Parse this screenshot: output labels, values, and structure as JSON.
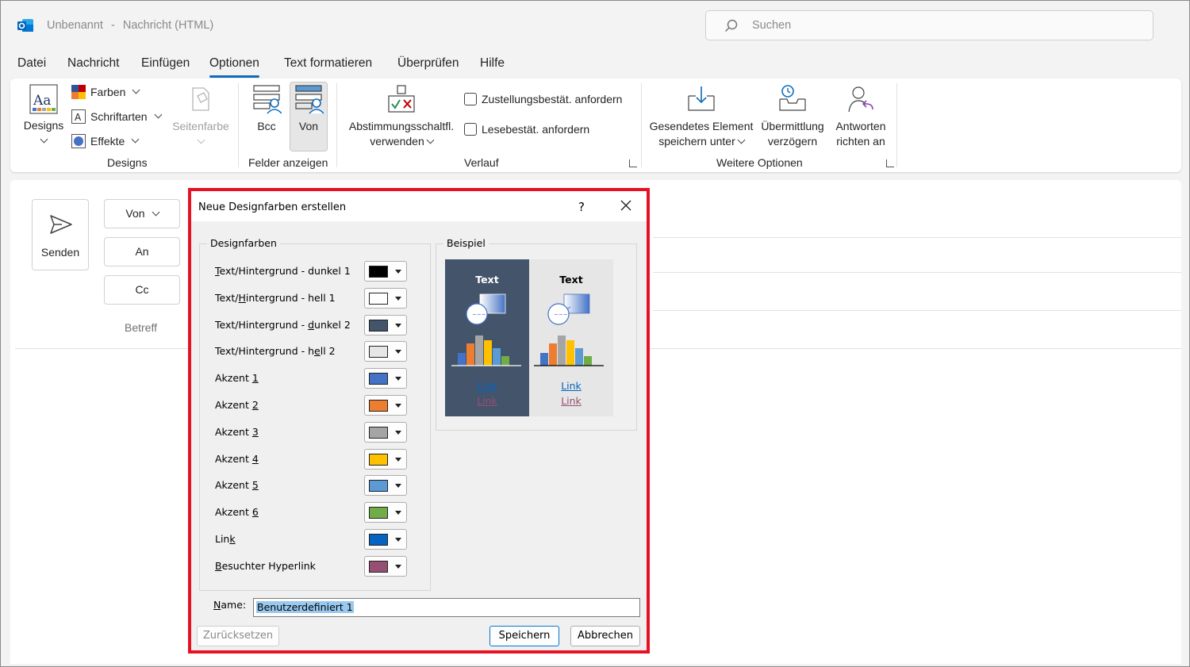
{
  "window": {
    "app_name": "Unbenannt",
    "separator": "-",
    "message_type": "Nachricht (HTML)",
    "search_placeholder": "Suchen"
  },
  "menu": [
    "Datei",
    "Nachricht",
    "Einfügen",
    "Optionen",
    "Text formatieren",
    "Überprüfen",
    "Hilfe"
  ],
  "menu_active": "Optionen",
  "ribbon": {
    "designs": {
      "designs_label": "Designs",
      "farben": "Farben",
      "schriftarten": "Schriftarten",
      "effekte": "Effekte",
      "seitenfarbe": "Seitenfarbe",
      "group": "Designs"
    },
    "felder": {
      "bcc": "Bcc",
      "von": "Von",
      "group": "Felder anzeigen"
    },
    "verlauf": {
      "abstimmung_line1": "Abstimmungsschaltfl.",
      "abstimmung_line2": "verwenden",
      "zustellung": "Zustellungsbestät. anfordern",
      "lese": "Lesebestät. anfordern",
      "group": "Verlauf"
    },
    "weitere": {
      "gesendet_line1": "Gesendetes Element",
      "gesendet_line2": "speichern unter",
      "uebermittlung_line1": "Übermittlung",
      "uebermittlung_line2": "verzögern",
      "antworten_line1": "Antworten",
      "antworten_line2": "richten an",
      "group": "Weitere Optionen"
    }
  },
  "compose": {
    "send": "Senden",
    "von": "Von",
    "an": "An",
    "cc": "Cc",
    "betreff": "Betreff"
  },
  "dialog": {
    "title": "Neue Designfarben erstellen",
    "help": "?",
    "group_colors": "Designfarben",
    "group_preview": "Beispiel",
    "rows": [
      {
        "pre": "",
        "key": "T",
        "post": "ext/Hintergrund - dunkel 1",
        "color": "#000000"
      },
      {
        "pre": "Text/",
        "key": "H",
        "post": "intergrund - hell 1",
        "color": "#ffffff"
      },
      {
        "pre": "Text/Hintergrund - ",
        "key": "d",
        "post": "unkel 2",
        "color": "#44546a"
      },
      {
        "pre": "Text/Hintergrund - h",
        "key": "e",
        "post": "ll 2",
        "color": "#e7e6e6"
      },
      {
        "pre": "Akzent ",
        "key": "1",
        "post": "",
        "color": "#4472c4"
      },
      {
        "pre": "Akzent ",
        "key": "2",
        "post": "",
        "color": "#ed7d31"
      },
      {
        "pre": "Akzent ",
        "key": "3",
        "post": "",
        "color": "#a5a5a5"
      },
      {
        "pre": "Akzent ",
        "key": "4",
        "post": "",
        "color": "#ffc000"
      },
      {
        "pre": "Akzent ",
        "key": "5",
        "post": "",
        "color": "#5b9bd5"
      },
      {
        "pre": "Akzent ",
        "key": "6",
        "post": "",
        "color": "#70ad47"
      },
      {
        "pre": "Lin",
        "key": "k",
        "post": "",
        "color": "#0563c1"
      },
      {
        "pre": "",
        "key": "B",
        "post": "esuchter Hyperlink",
        "color": "#954f72"
      }
    ],
    "preview": {
      "text": "Text",
      "link": "Link",
      "visited": "Link"
    },
    "name_label_key": "N",
    "name_label_rest": "ame:",
    "name_value": "Benutzerdefiniert 1",
    "reset": "Zurücksetzen",
    "save": "Speichern",
    "cancel": "Abbrechen"
  },
  "colors": {
    "accent_blue": "#0f6cbd",
    "highlight_red": "#e81123",
    "preview_dark": "#44546a",
    "preview_light": "#e7e6e6"
  }
}
